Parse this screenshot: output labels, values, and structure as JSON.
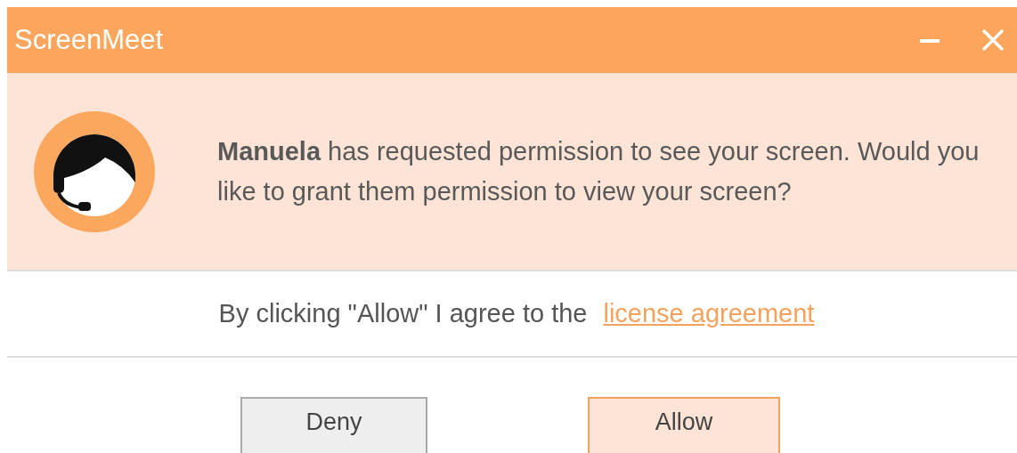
{
  "window": {
    "title": "ScreenMeet"
  },
  "message": "**Manuela** has requested permission to see your screen. Would you like to grant them permission to view your screen?",
  "agreement": {
    "text": "By clicking \"Allow\" I agree to the",
    "link": "license agreement"
  },
  "buttons": [
    {
      "label": "Deny",
      "kind": "secondary"
    },
    {
      "label": "Allow",
      "kind": "primary"
    }
  ]
}
